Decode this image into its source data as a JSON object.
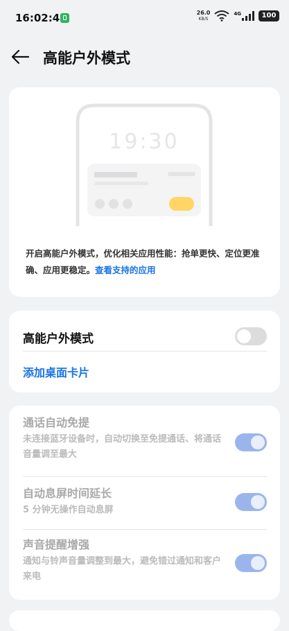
{
  "status_bar": {
    "time": "16:02:42",
    "network_speed": "26.0",
    "network_speed_unit": "KB/S",
    "wifi_icon": "wifi-icon",
    "signal_label": "4G",
    "battery": "100"
  },
  "header": {
    "back_icon": "arrow-left-icon",
    "title": "高能户外模式"
  },
  "intro": {
    "illustration_time": "19:30",
    "description": "开启高能户外模式，优化相关应用性能：抢单更快、定位更准确、应用更稳定。",
    "link": "查看支持的应用"
  },
  "main_toggle": {
    "label": "高能户外模式",
    "enabled": false
  },
  "add_card_link": "添加桌面卡片",
  "features": [
    {
      "title": "通话自动免提",
      "description": "未连接蓝牙设备时，自动切换至免提通话、将通话音量调至最大",
      "enabled": true
    },
    {
      "title": "自动息屏时间延长",
      "description": "5 分钟无操作自动息屏",
      "enabled": true
    },
    {
      "title": "声音提醒增强",
      "description": "通知与铃声音量调整到最大，避免错过通知和客户来电",
      "enabled": true
    }
  ],
  "colors": {
    "accent": "#1a73e8",
    "background": "#f1f2f4",
    "card": "#ffffff",
    "toggle_off": "#dcdcde",
    "toggle_on_disabled": "#9bb5ec",
    "notification": "#2db55d",
    "illustration_button": "#ffd666"
  }
}
